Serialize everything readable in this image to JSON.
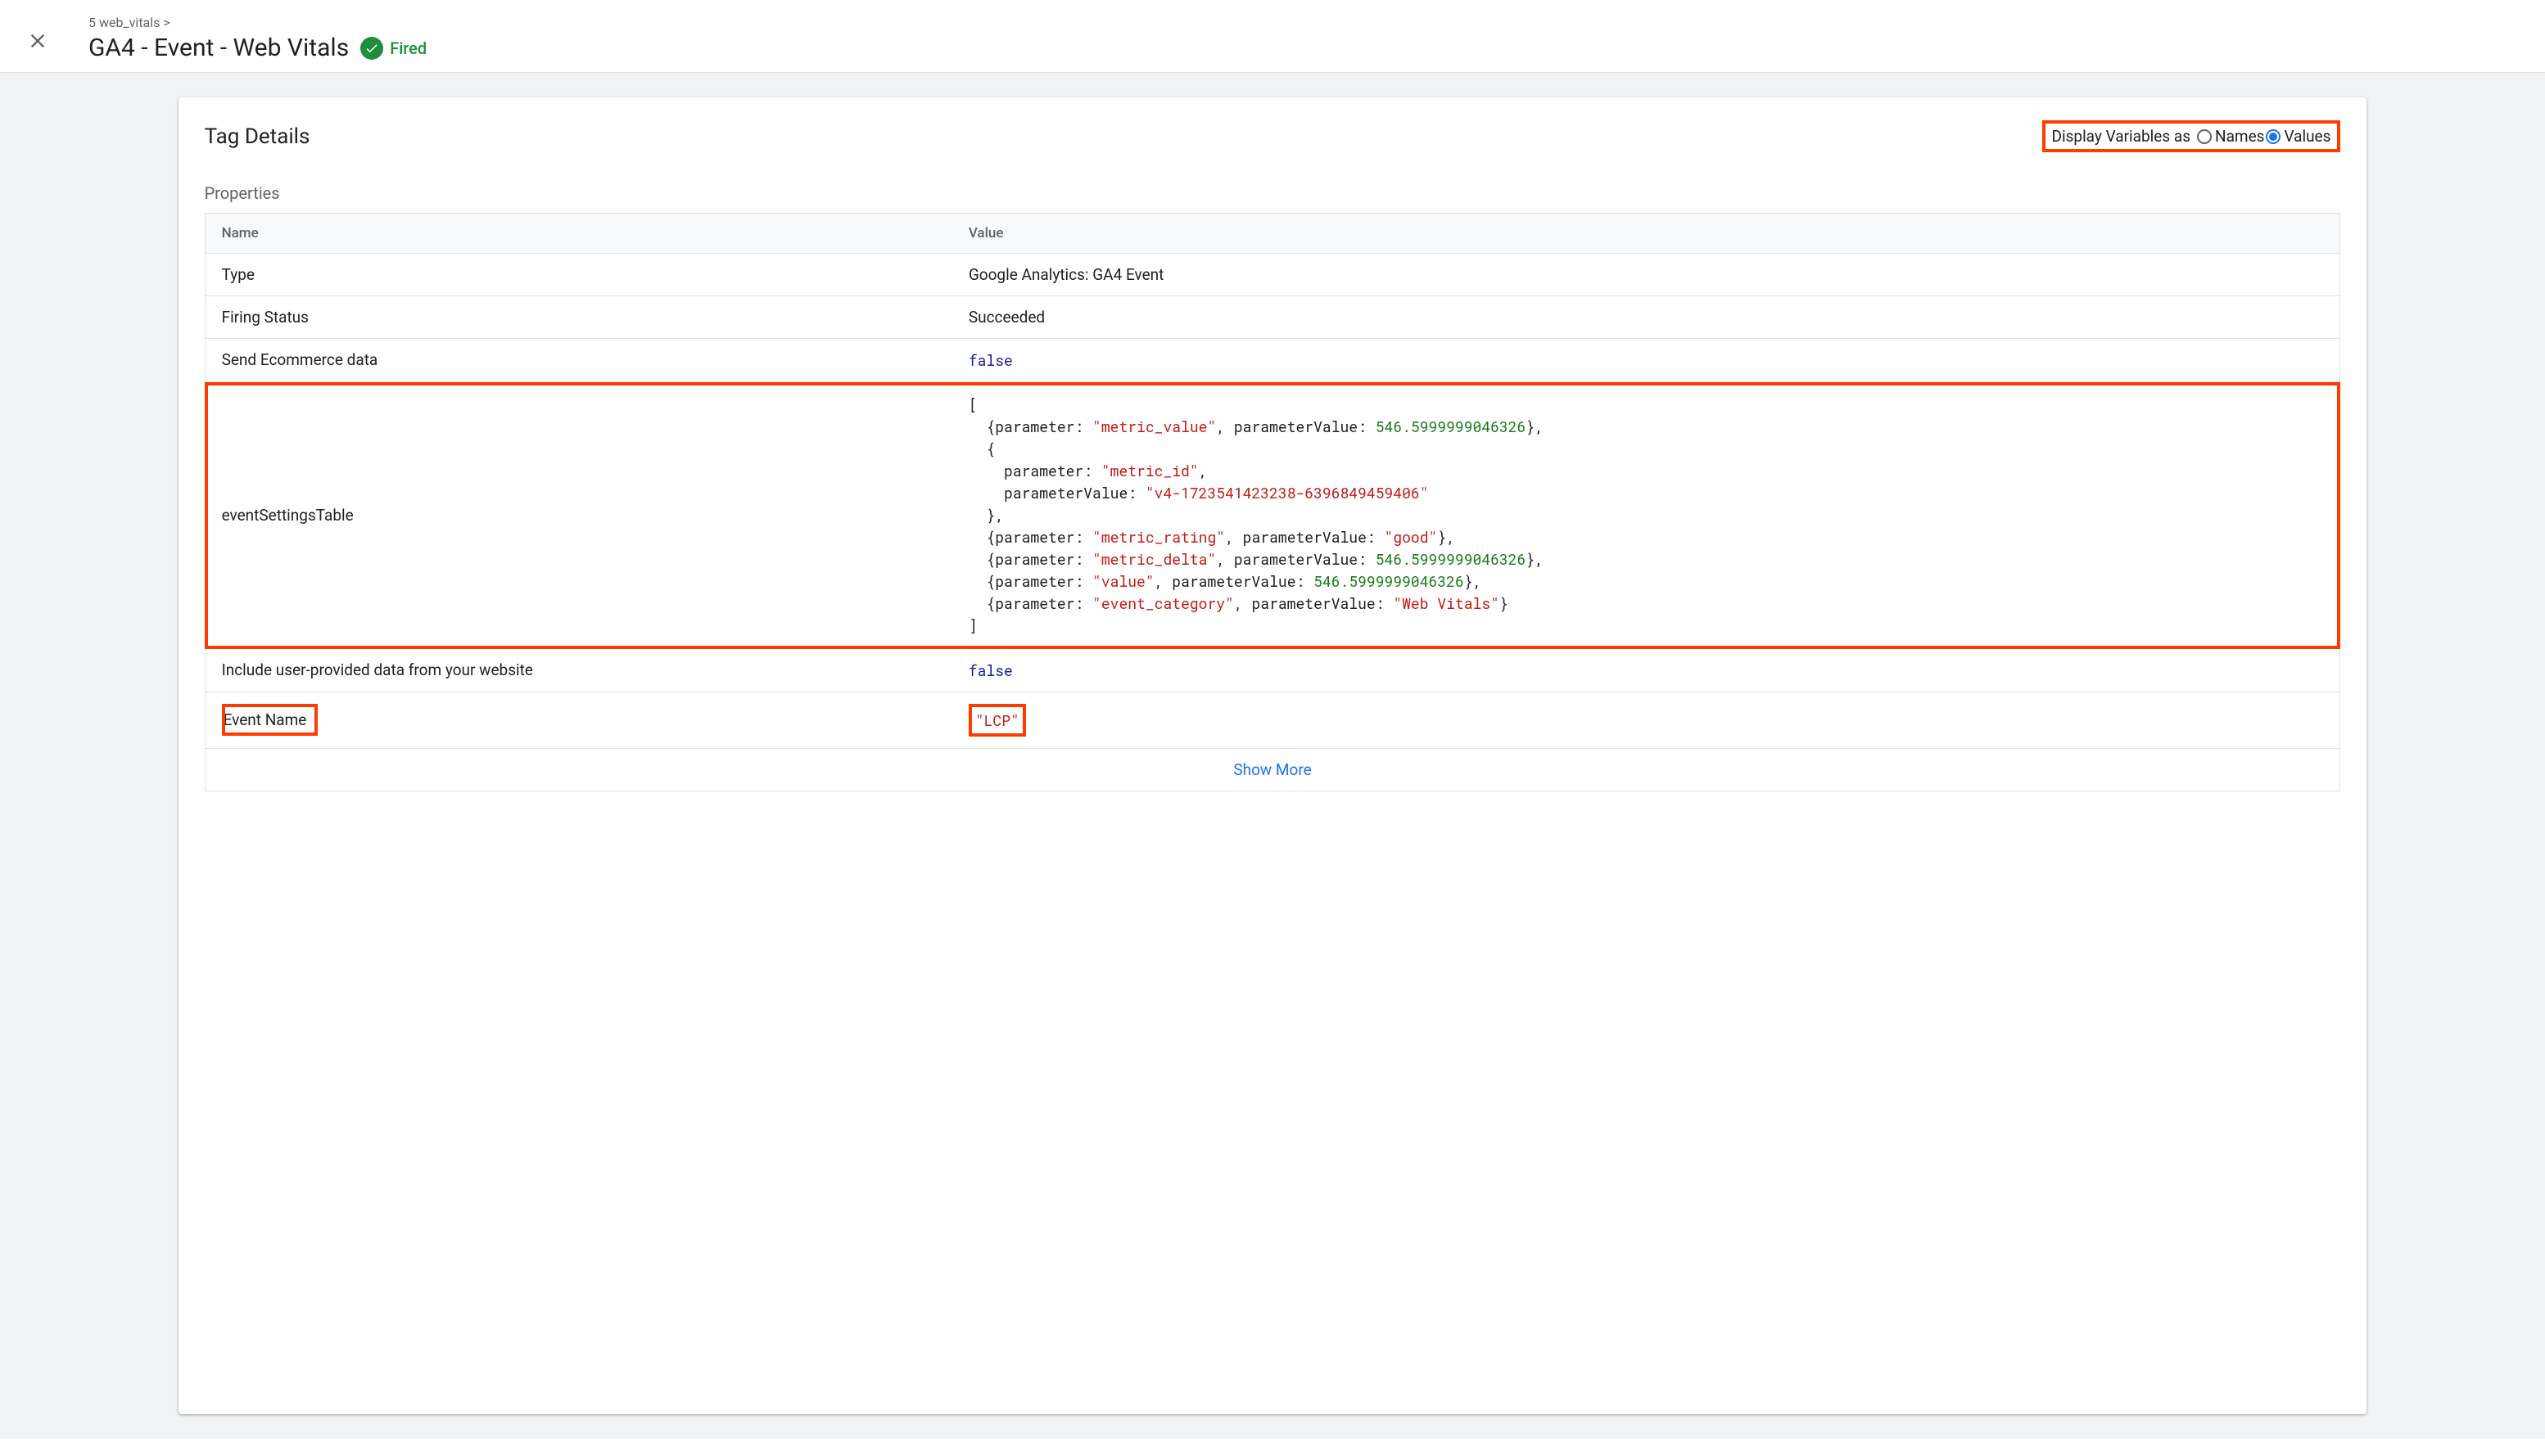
{
  "header": {
    "breadcrumb": "5 web_vitals >",
    "title": "GA4 - Event - Web Vitals",
    "fired_label": "Fired"
  },
  "card": {
    "title": "Tag Details",
    "display_toggle": {
      "label": "Display Variables as",
      "option_names": "Names",
      "option_values": "Values",
      "selected": "values"
    },
    "section_label": "Properties",
    "columns": {
      "name": "Name",
      "value": "Value"
    },
    "rows": {
      "type": {
        "name": "Type",
        "value": "Google Analytics: GA4 Event"
      },
      "firing_status": {
        "name": "Firing Status",
        "value": "Succeeded"
      },
      "send_ecommerce": {
        "name": "Send Ecommerce data",
        "value": "false"
      },
      "event_settings": {
        "name": "eventSettingsTable",
        "items": [
          {
            "parameter": "metric_value",
            "value_type": "number",
            "value": "546.5999999046326"
          },
          {
            "parameter": "metric_id",
            "value_type": "string",
            "value": "v4-1723541423238-6396849459406",
            "multiline": true
          },
          {
            "parameter": "metric_rating",
            "value_type": "string",
            "value": "good"
          },
          {
            "parameter": "metric_delta",
            "value_type": "number",
            "value": "546.5999999046326"
          },
          {
            "parameter": "value",
            "value_type": "number",
            "value": "546.5999999046326"
          },
          {
            "parameter": "event_category",
            "value_type": "string",
            "value": "Web Vitals"
          }
        ]
      },
      "include_user_data": {
        "name": "Include user-provided data from your website",
        "value": "false"
      },
      "event_name": {
        "name": "Event Name",
        "value": "\"LCP\""
      }
    },
    "show_more": "Show More"
  }
}
